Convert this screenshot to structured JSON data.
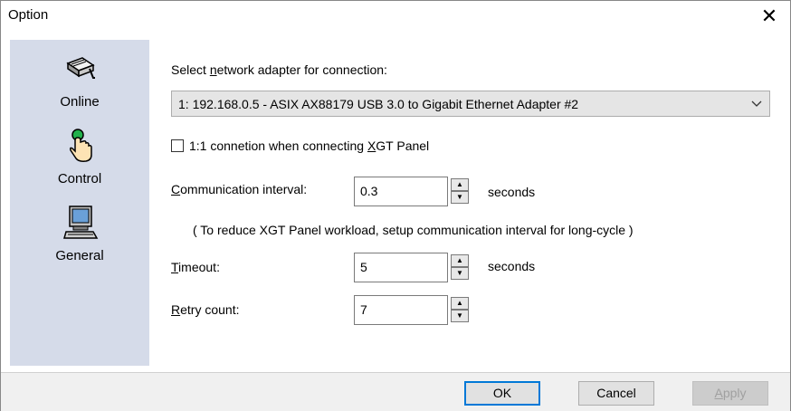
{
  "window": {
    "title": "Option",
    "close_glyph": "✕"
  },
  "sidebar": {
    "items": [
      {
        "label": "Online",
        "icon": "network-connector-icon"
      },
      {
        "label": "Control",
        "icon": "hand-pointer-icon"
      },
      {
        "label": "General",
        "icon": "computer-icon"
      }
    ]
  },
  "adapter": {
    "label_pre": "Select ",
    "label_u": "n",
    "label_post": "etwork adapter for connection:",
    "selected": "1: 192.168.0.5 - ASIX AX88179 USB 3.0 to Gigabit Ethernet Adapter #2"
  },
  "xgt": {
    "checked": false,
    "label_pre": "1:1 connetion when connecting ",
    "label_u": "X",
    "label_post": "GT Panel"
  },
  "interval": {
    "label_u": "C",
    "label_post": "ommunication interval:",
    "value": "0.3",
    "unit": "seconds",
    "note": "( To reduce XGT Panel workload, setup communication interval for long-cycle )"
  },
  "timeout": {
    "label_u": "T",
    "label_post": "imeout:",
    "value": "5",
    "unit": "seconds"
  },
  "retry": {
    "label_u": "R",
    "label_post": "etry count:",
    "value": "7"
  },
  "buttons": {
    "ok": "OK",
    "cancel": "Cancel",
    "apply_u": "A",
    "apply_post": "pply"
  },
  "colors": {
    "sidebar_bg": "#d5dbe9",
    "default_button_border": "#0078d7"
  }
}
